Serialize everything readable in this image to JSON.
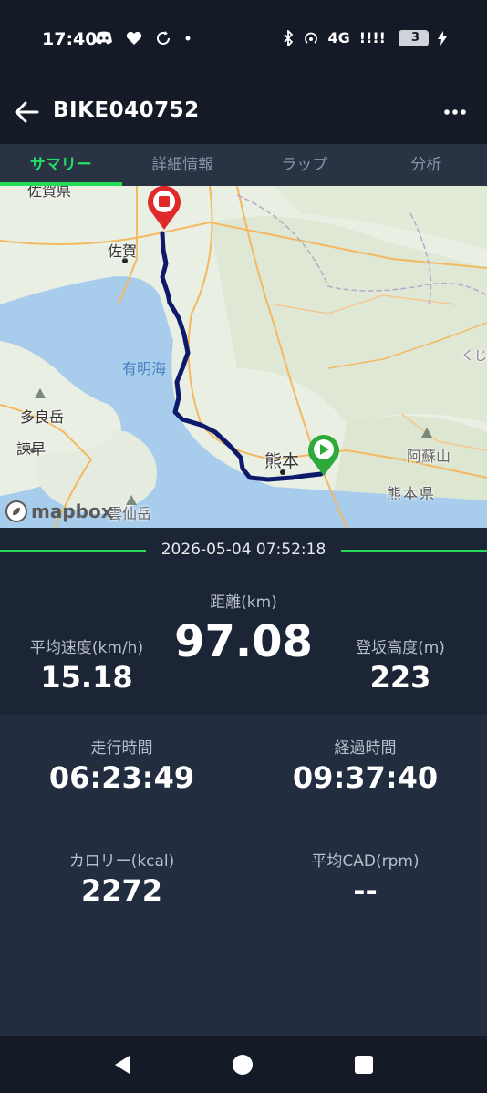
{
  "status": {
    "time": "17:40",
    "network": "4G",
    "signal": "!!!!",
    "battery": "3"
  },
  "app_bar": {
    "title": "BIKE040752"
  },
  "tabs": [
    {
      "label": "サマリー",
      "active": true
    },
    {
      "label": "詳細情報",
      "active": false
    },
    {
      "label": "ラップ",
      "active": false
    },
    {
      "label": "分析",
      "active": false
    }
  ],
  "map": {
    "labels": {
      "saga_pref": "佐賀県",
      "saga": "佐賀",
      "ariake": "有明海",
      "tara": "多良岳",
      "isahaya": "諫早",
      "kumamoto": "熊本",
      "aso": "阿蘇山",
      "kumamoto_pref": "熊本県",
      "unzen": "雲仙岳",
      "kuji": "くじ"
    },
    "attribution": "mapbox",
    "colors": {
      "route": "#0d1a6b",
      "start_marker": "#2eaa3c",
      "end_marker": "#e02a2a",
      "water": "#a8cdec",
      "land": "#e9efe3"
    }
  },
  "summary": {
    "date": "2026-05-04 07:52:18",
    "distance_label": "距離(km)",
    "distance_value": "97.08",
    "avg_speed_label": "平均速度(km/h)",
    "avg_speed_value": "15.18",
    "climb_label": "登坂高度(m)",
    "climb_value": "223",
    "ride_time_label": "走行時間",
    "ride_time_value": "06:23:49",
    "elapsed_time_label": "経過時間",
    "elapsed_time_value": "09:37:40",
    "calories_label": "カロリー(kcal)",
    "calories_value": "2272",
    "avg_cad_label": "平均CAD(rpm)",
    "avg_cad_value": "--"
  },
  "colors": {
    "accent": "#22dd55",
    "background": "#1c2535",
    "panel": "#222d40",
    "bar": "#141b27"
  }
}
